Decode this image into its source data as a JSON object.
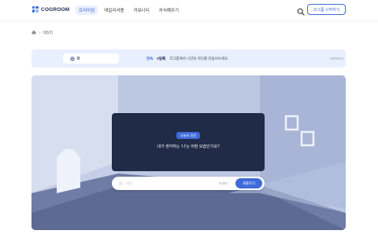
{
  "header": {
    "logo_text": "COGROOM",
    "nav": [
      {
        "label": "프리미엄",
        "active": true
      },
      {
        "label": "데일리셔용",
        "active": false
      },
      {
        "label": "커뮤니티",
        "active": false
      },
      {
        "label": "자식해우기",
        "active": false
      }
    ],
    "start_label": "코그룸 시작하기",
    "accent": "#3f6bd9"
  },
  "breadcrumb": {
    "home_icon": "home-icon",
    "separator": ">",
    "current": "데일리"
  },
  "infobar": {
    "coin_count": "0",
    "streak_label": "연속",
    "streak_days": "0일째",
    "message": "코그룸에서 나만의 하다를 만들어보세요",
    "date": "26/05/12"
  },
  "question": {
    "badge": "오늘의 질문",
    "text": "내가 생각하는 '나'는 어떤 모습인가요?"
  },
  "answer": {
    "placeholder": "음... 나는",
    "value": "",
    "count": "0/300",
    "submit_label": "제출하기"
  }
}
